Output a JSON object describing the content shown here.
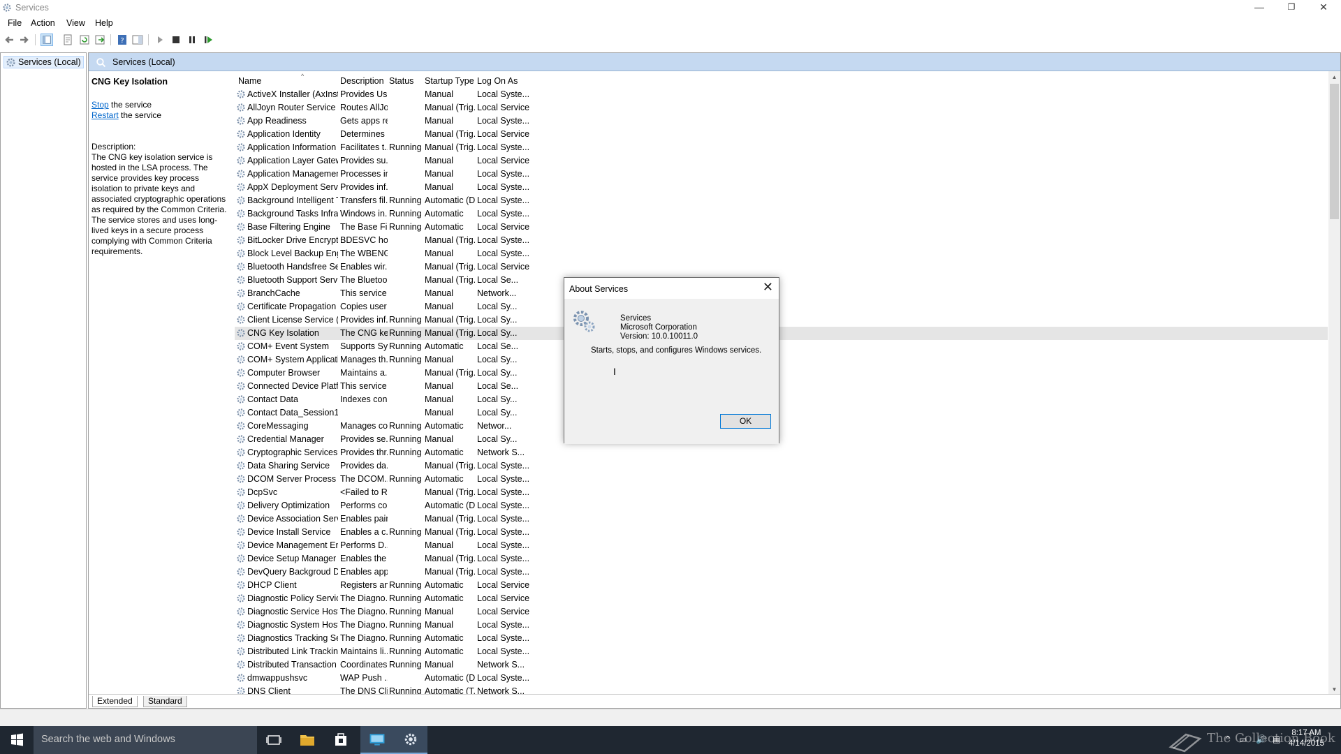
{
  "window": {
    "title": "Services",
    "minimize": "—",
    "restore": "❐",
    "close": "✕"
  },
  "menu": [
    "File",
    "Action",
    "View",
    "Help"
  ],
  "tree": {
    "root_label": "Services (Local)"
  },
  "header": {
    "label": "Services (Local)"
  },
  "details": {
    "service_name": "CNG Key Isolation",
    "stop_link": "Stop",
    "stop_suffix": " the service",
    "restart_link": "Restart",
    "restart_suffix": " the service",
    "desc_label": "Description:",
    "description": "The CNG key isolation service is hosted in the LSA process. The service provides key process isolation to private keys and associated cryptographic operations as required by the Common Criteria. The service stores and uses long-lived keys in a secure process complying with Common Criteria requirements."
  },
  "columns": [
    "Name",
    "Description",
    "Status",
    "Startup Type",
    "Log On As"
  ],
  "services": [
    [
      "ActiveX Installer (AxInstSV)",
      "Provides Us...",
      "",
      "Manual",
      "Local Syste..."
    ],
    [
      "AllJoyn Router Service",
      "Routes AllJo...",
      "",
      "Manual (Trig...",
      "Local Service"
    ],
    [
      "App Readiness",
      "Gets apps re...",
      "",
      "Manual",
      "Local Syste..."
    ],
    [
      "Application Identity",
      "Determines ...",
      "",
      "Manual (Trig...",
      "Local Service"
    ],
    [
      "Application Information",
      "Facilitates t...",
      "Running",
      "Manual (Trig...",
      "Local Syste..."
    ],
    [
      "Application Layer Gateway ...",
      "Provides su...",
      "",
      "Manual",
      "Local Service"
    ],
    [
      "Application Management",
      "Processes in...",
      "",
      "Manual",
      "Local Syste..."
    ],
    [
      "AppX Deployment Service (...",
      "Provides inf...",
      "",
      "Manual",
      "Local Syste..."
    ],
    [
      "Background Intelligent Tran...",
      "Transfers fil...",
      "Running",
      "Automatic (D...",
      "Local Syste..."
    ],
    [
      "Background Tasks Infrastru...",
      "Windows in...",
      "Running",
      "Automatic",
      "Local Syste..."
    ],
    [
      "Base Filtering Engine",
      "The Base Fil...",
      "Running",
      "Automatic",
      "Local Service"
    ],
    [
      "BitLocker Drive Encryption ...",
      "BDESVC hos...",
      "",
      "Manual (Trig...",
      "Local Syste..."
    ],
    [
      "Block Level Backup Engine ...",
      "The WBENG...",
      "",
      "Manual",
      "Local Syste..."
    ],
    [
      "Bluetooth Handsfree Service",
      "Enables wir...",
      "",
      "Manual (Trig...",
      "Local Service"
    ],
    [
      "Bluetooth Support Service",
      "The Bluetoo...",
      "",
      "Manual (Trig...",
      "Local Se..."
    ],
    [
      "BranchCache",
      "This service ...",
      "",
      "Manual",
      "Network..."
    ],
    [
      "Certificate Propagation",
      "Copies user ...",
      "",
      "Manual",
      "Local Sy..."
    ],
    [
      "Client License Service (ClipS...",
      "Provides inf...",
      "Running",
      "Manual (Trig...",
      "Local Sy..."
    ],
    [
      "CNG Key Isolation",
      "The CNG ke...",
      "Running",
      "Manual (Trig...",
      "Local Sy..."
    ],
    [
      "COM+ Event System",
      "Supports Sy...",
      "Running",
      "Automatic",
      "Local Se..."
    ],
    [
      "COM+ System Application",
      "Manages th...",
      "Running",
      "Manual",
      "Local Sy..."
    ],
    [
      "Computer Browser",
      "Maintains a...",
      "",
      "Manual (Trig...",
      "Local Sy..."
    ],
    [
      "Connected Device Platform...",
      "This service ...",
      "",
      "Manual",
      "Local Se..."
    ],
    [
      "Contact Data",
      "Indexes con...",
      "",
      "Manual",
      "Local Sy..."
    ],
    [
      "Contact Data_Session1",
      "",
      "",
      "Manual",
      "Local Sy..."
    ],
    [
      "CoreMessaging",
      "Manages co...",
      "Running",
      "Automatic",
      "Networ..."
    ],
    [
      "Credential Manager",
      "Provides se...",
      "Running",
      "Manual",
      "Local Sy..."
    ],
    [
      "Cryptographic Services",
      "Provides thr...",
      "Running",
      "Automatic",
      "Network S..."
    ],
    [
      "Data Sharing Service",
      "Provides da...",
      "",
      "Manual (Trig...",
      "Local Syste..."
    ],
    [
      "DCOM Server Process Laun...",
      "The DCOM...",
      "Running",
      "Automatic",
      "Local Syste..."
    ],
    [
      "DcpSvc",
      "<Failed to R...",
      "",
      "Manual (Trig...",
      "Local Syste..."
    ],
    [
      "Delivery Optimization",
      "Performs co...",
      "",
      "Automatic (D...",
      "Local Syste..."
    ],
    [
      "Device Association Service",
      "Enables pair...",
      "",
      "Manual (Trig...",
      "Local Syste..."
    ],
    [
      "Device Install Service",
      "Enables a c...",
      "Running",
      "Manual (Trig...",
      "Local Syste..."
    ],
    [
      "Device Management Enroll...",
      "Performs D...",
      "",
      "Manual",
      "Local Syste..."
    ],
    [
      "Device Setup Manager",
      "Enables the ...",
      "",
      "Manual (Trig...",
      "Local Syste..."
    ],
    [
      "DevQuery Backgroud Disco...",
      "Enables app...",
      "",
      "Manual (Trig...",
      "Local Syste..."
    ],
    [
      "DHCP Client",
      "Registers an...",
      "Running",
      "Automatic",
      "Local Service"
    ],
    [
      "Diagnostic Policy Service",
      "The Diagno...",
      "Running",
      "Automatic",
      "Local Service"
    ],
    [
      "Diagnostic Service Host",
      "The Diagno...",
      "Running",
      "Manual",
      "Local Service"
    ],
    [
      "Diagnostic System Host",
      "The Diagno...",
      "Running",
      "Manual",
      "Local Syste..."
    ],
    [
      "Diagnostics Tracking Service",
      "The Diagno...",
      "Running",
      "Automatic",
      "Local Syste..."
    ],
    [
      "Distributed Link Tracking Cl...",
      "Maintains li...",
      "Running",
      "Automatic",
      "Local Syste..."
    ],
    [
      "Distributed Transaction Coo...",
      "Coordinates...",
      "Running",
      "Manual",
      "Network S..."
    ],
    [
      "dmwappushsvc",
      "WAP Push ...",
      "",
      "Automatic (D...",
      "Local Syste..."
    ],
    [
      "DNS Client",
      "The DNS Cli...",
      "Running",
      "Automatic (T...",
      "Network S..."
    ]
  ],
  "selected_index": 18,
  "tabs": [
    "Extended",
    "Standard"
  ],
  "dialog": {
    "title": "About Services",
    "close": "✕",
    "product": "Services",
    "company": "Microsoft Corporation",
    "version": "Version: 10.0.10011.0",
    "blurb": "Starts, stops, and configures Windows services.",
    "ok": "OK"
  },
  "taskbar": {
    "search_placeholder": "Search the web and Windows",
    "time": "8:17 AM",
    "date": "4/14/2015",
    "watermark": "The Collection Book"
  },
  "colors": {
    "accent": "#0078d7",
    "header_bg": "#c5d9f1",
    "taskbar_bg": "#1f2731",
    "link": "#0066cc"
  }
}
